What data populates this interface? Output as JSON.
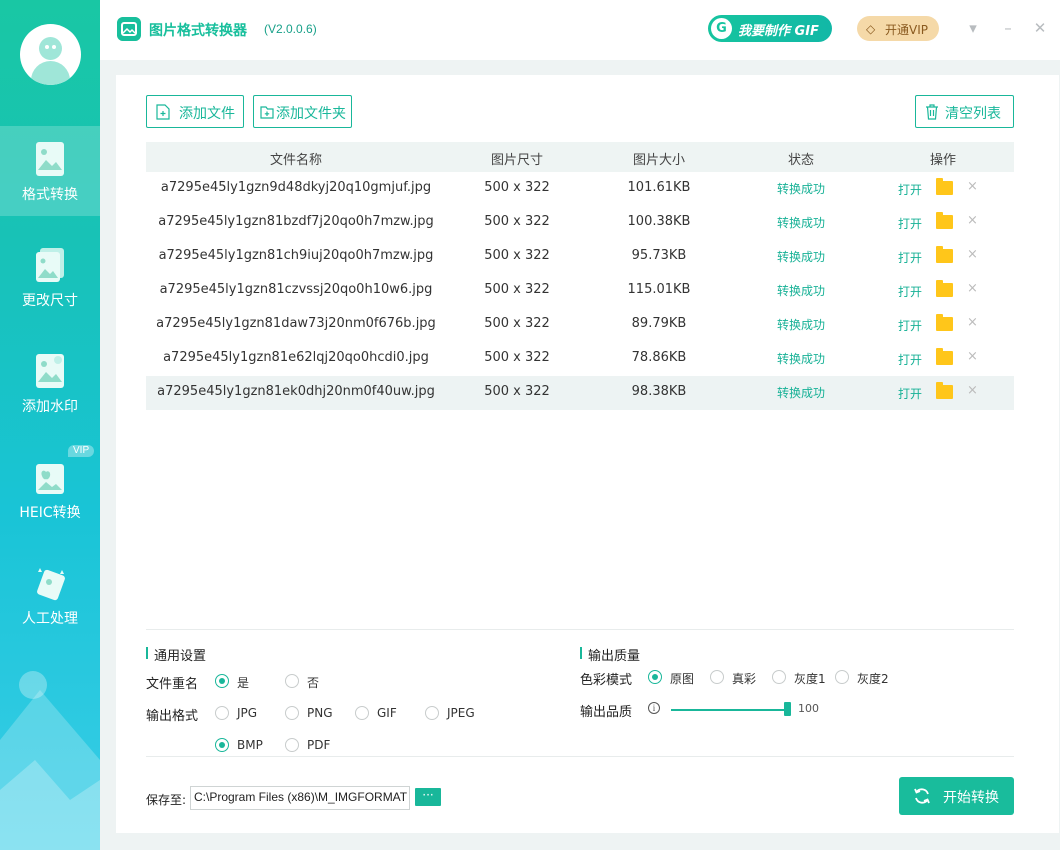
{
  "app": {
    "title": "图片格式转换器",
    "version": "(V2.0.0.6)",
    "gif_button": "我要制作 GIF",
    "gif_badge": "G",
    "vip_button": "开通VIP",
    "accent_color": "#19b79a"
  },
  "sidebar": {
    "items": [
      {
        "label": "格式转换",
        "icon": "image-convert-icon",
        "active": true
      },
      {
        "label": "更改尺寸",
        "icon": "image-resize-icon",
        "active": false
      },
      {
        "label": "添加水印",
        "icon": "image-watermark-icon",
        "active": false
      },
      {
        "label": "HEIC转换",
        "icon": "heic-convert-icon",
        "active": false,
        "badge": "VIP"
      },
      {
        "label": "人工处理",
        "icon": "manual-process-icon",
        "active": false
      }
    ]
  },
  "toolbar": {
    "add_file": "添加文件",
    "add_folder": "添加文件夹",
    "clear_list": "清空列表"
  },
  "table": {
    "headers": [
      "文件名称",
      "图片尺寸",
      "图片大小",
      "状态",
      "操作"
    ],
    "open_label": "打开",
    "delete_label": "×",
    "rows": [
      {
        "name": "a7295e45ly1gzn9d48dkyj20q10gmjuf.jpg",
        "size": "500 x 322",
        "filesize": "101.61KB",
        "status": "转换成功"
      },
      {
        "name": "a7295e45ly1gzn81bzdf7j20qo0h7mzw.jpg",
        "size": "500 x 322",
        "filesize": "100.38KB",
        "status": "转换成功"
      },
      {
        "name": "a7295e45ly1gzn81ch9iuj20qo0h7mzw.jpg",
        "size": "500 x 322",
        "filesize": "95.73KB",
        "status": "转换成功"
      },
      {
        "name": "a7295e45ly1gzn81czvssj20qo0h10w6.jpg",
        "size": "500 x 322",
        "filesize": "115.01KB",
        "status": "转换成功"
      },
      {
        "name": "a7295e45ly1gzn81daw73j20nm0f676b.jpg",
        "size": "500 x 322",
        "filesize": "89.79KB",
        "status": "转换成功"
      },
      {
        "name": "a7295e45ly1gzn81e62lqj20qo0hcdi0.jpg",
        "size": "500 x 322",
        "filesize": "78.86KB",
        "status": "转换成功"
      },
      {
        "name": "a7295e45ly1gzn81ek0dhj20nm0f40uw.jpg",
        "size": "500 x 322",
        "filesize": "98.38KB",
        "status": "转换成功",
        "selected": true
      }
    ]
  },
  "settings": {
    "general_title": "通用设置",
    "rename_label": "文件重名",
    "rename_options": [
      "是",
      "否"
    ],
    "rename_selected": "是",
    "format_label": "输出格式",
    "format_options": [
      "JPG",
      "PNG",
      "GIF",
      "JPEG",
      "BMP",
      "PDF"
    ],
    "format_selected": "BMP",
    "quality_title": "输出质量",
    "color_label": "色彩模式",
    "color_options": [
      "原图",
      "真彩",
      "灰度1",
      "灰度2"
    ],
    "color_selected": "原图",
    "quality_label": "输出品质",
    "quality_value": "100"
  },
  "footer": {
    "save_label": "保存至:",
    "save_path": "C:\\Program Files (x86)\\M_IMGFORMAT",
    "browse_label": "···",
    "start_button": "开始转换"
  }
}
